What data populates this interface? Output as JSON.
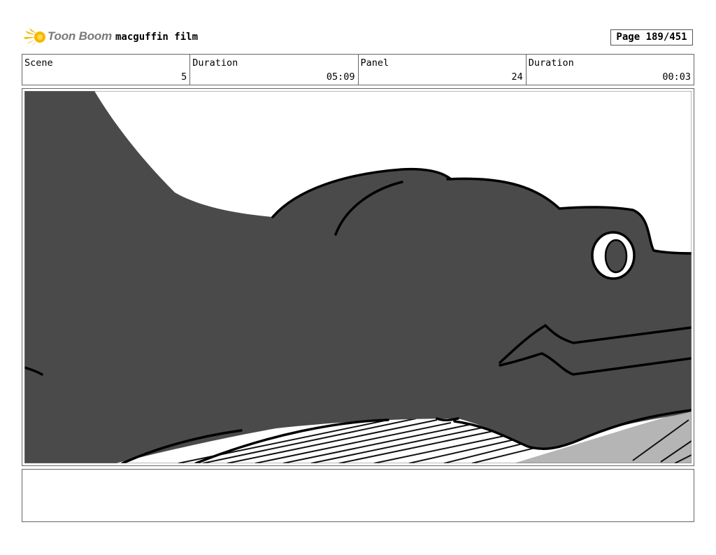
{
  "header": {
    "logo_text": "Toon Boom",
    "project_title": "macguffin film",
    "page": "Page 189/451"
  },
  "info": {
    "scene_label": "Scene",
    "scene_value": "5",
    "scene_duration_label": "Duration",
    "scene_duration_value": "05:09",
    "panel_label": "Panel",
    "panel_value": "24",
    "panel_duration_label": "Duration",
    "panel_duration_value": "00:03"
  },
  "panel": {
    "drawing": "storyboard-sketch"
  },
  "notes": {
    "text": ""
  }
}
